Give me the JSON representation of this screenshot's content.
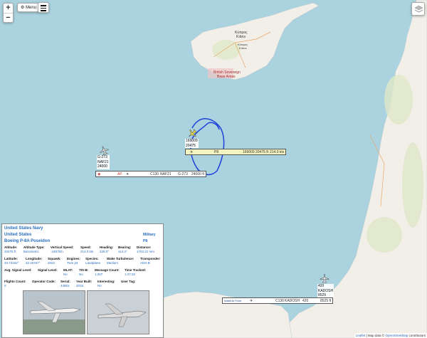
{
  "map": {
    "place_labels": {
      "cyprus_name": "Κύπρος",
      "cyprus_name_tr": "Kıbrıs",
      "cyprus_city": "Κύπρος",
      "cyprus_city_tr": "Kıbrıs",
      "sovereign_base": "British Sovereign",
      "sovereign_base_2": "Base Areas"
    },
    "colors": {
      "sea": "#aad3df",
      "land": "#f2efe9",
      "track": "#1f3fd9"
    }
  },
  "controls": {
    "zoom_in": "+",
    "zoom_out": "−",
    "menu_label": "Menu",
    "menu_icon": "gear-icon",
    "list_icon": "list-icon",
    "layers_icon": "layers-icon"
  },
  "aircraft": [
    {
      "id": "g273",
      "lines": [
        "G-273",
        "NAF21",
        "24000"
      ]
    },
    {
      "id": "p8",
      "lines": [
        "169009",
        "20475"
      ]
    },
    {
      "id": "kadosh",
      "lines": [
        "420",
        "KADOSH",
        "8525"
      ]
    }
  ],
  "tracks": {
    "g273": {
      "type": "C130",
      "callsign": "NAF21",
      "reg": "G-273",
      "alt": "24000 ft",
      "carrier": "AF"
    },
    "p8": {
      "type": "P8",
      "reg": "169009",
      "alt": "20475 ft",
      "speed": "214.0 kts"
    },
    "kadosh": {
      "type": "C130",
      "callsign": "KADOSH",
      "reg": "420",
      "alt": "8525 ft",
      "badge": "Israeli Air Force"
    }
  },
  "panel": {
    "operator": "United States Navy",
    "country": "United States",
    "model": "Boeing P-8A Poseidon",
    "category": "Military",
    "type_code": "P8",
    "rows": [
      [
        {
          "label": "Altitude:",
          "value": "20475 ft"
        },
        {
          "label": "Altitude Type:",
          "value": "Barometric"
        },
        {
          "label": "Vertical Speed:",
          "value": "-448 ft/m"
        },
        {
          "label": "Speed:",
          "value": "214.0 kts"
        },
        {
          "label": "Heading:",
          "value": "229.0°"
        },
        {
          "label": "Bearing:",
          "value": "114.4°"
        },
        {
          "label": "Distance:",
          "value": "1762.21 nmi"
        }
      ],
      [
        {
          "label": "Latitude:",
          "value": "33.74162°"
        },
        {
          "label": "Longitude:",
          "value": "32.26767°"
        },
        {
          "label": "Squawk:",
          "value": "2022"
        },
        {
          "label": "Engines:",
          "value": "Twin jet"
        },
        {
          "label": "Species:",
          "value": "Landplane"
        },
        {
          "label": "Wake Turbulence:",
          "value": "Medium"
        },
        {
          "label": "Transponder:",
          "value": "ADS-B"
        }
      ],
      [
        {
          "label": "Avg. Signal Level:",
          "value": ""
        },
        {
          "label": "Signal Level:",
          "value": ""
        },
        {
          "label": "MLAT:",
          "value": "No"
        },
        {
          "label": "TIS-B:",
          "value": "No"
        },
        {
          "label": "Message Count:",
          "value": "1,007"
        },
        {
          "label": "Time Tracked:",
          "value": "1:27:32"
        }
      ],
      [
        {
          "label": "Flights Count:",
          "value": "0"
        },
        {
          "label": "Operator Code:",
          "value": ""
        },
        {
          "label": "Serial:",
          "value": "44951"
        },
        {
          "label": "Year Built:",
          "value": "2016"
        },
        {
          "label": "Interesting:",
          "value": "No"
        },
        {
          "label": "User Tag:",
          "value": ""
        }
      ]
    ]
  },
  "attribution": {
    "leaflet": "Leaflet",
    "sep": " | Map data © ",
    "osm": "OpenStreetMap",
    "contrib": " contributors"
  }
}
